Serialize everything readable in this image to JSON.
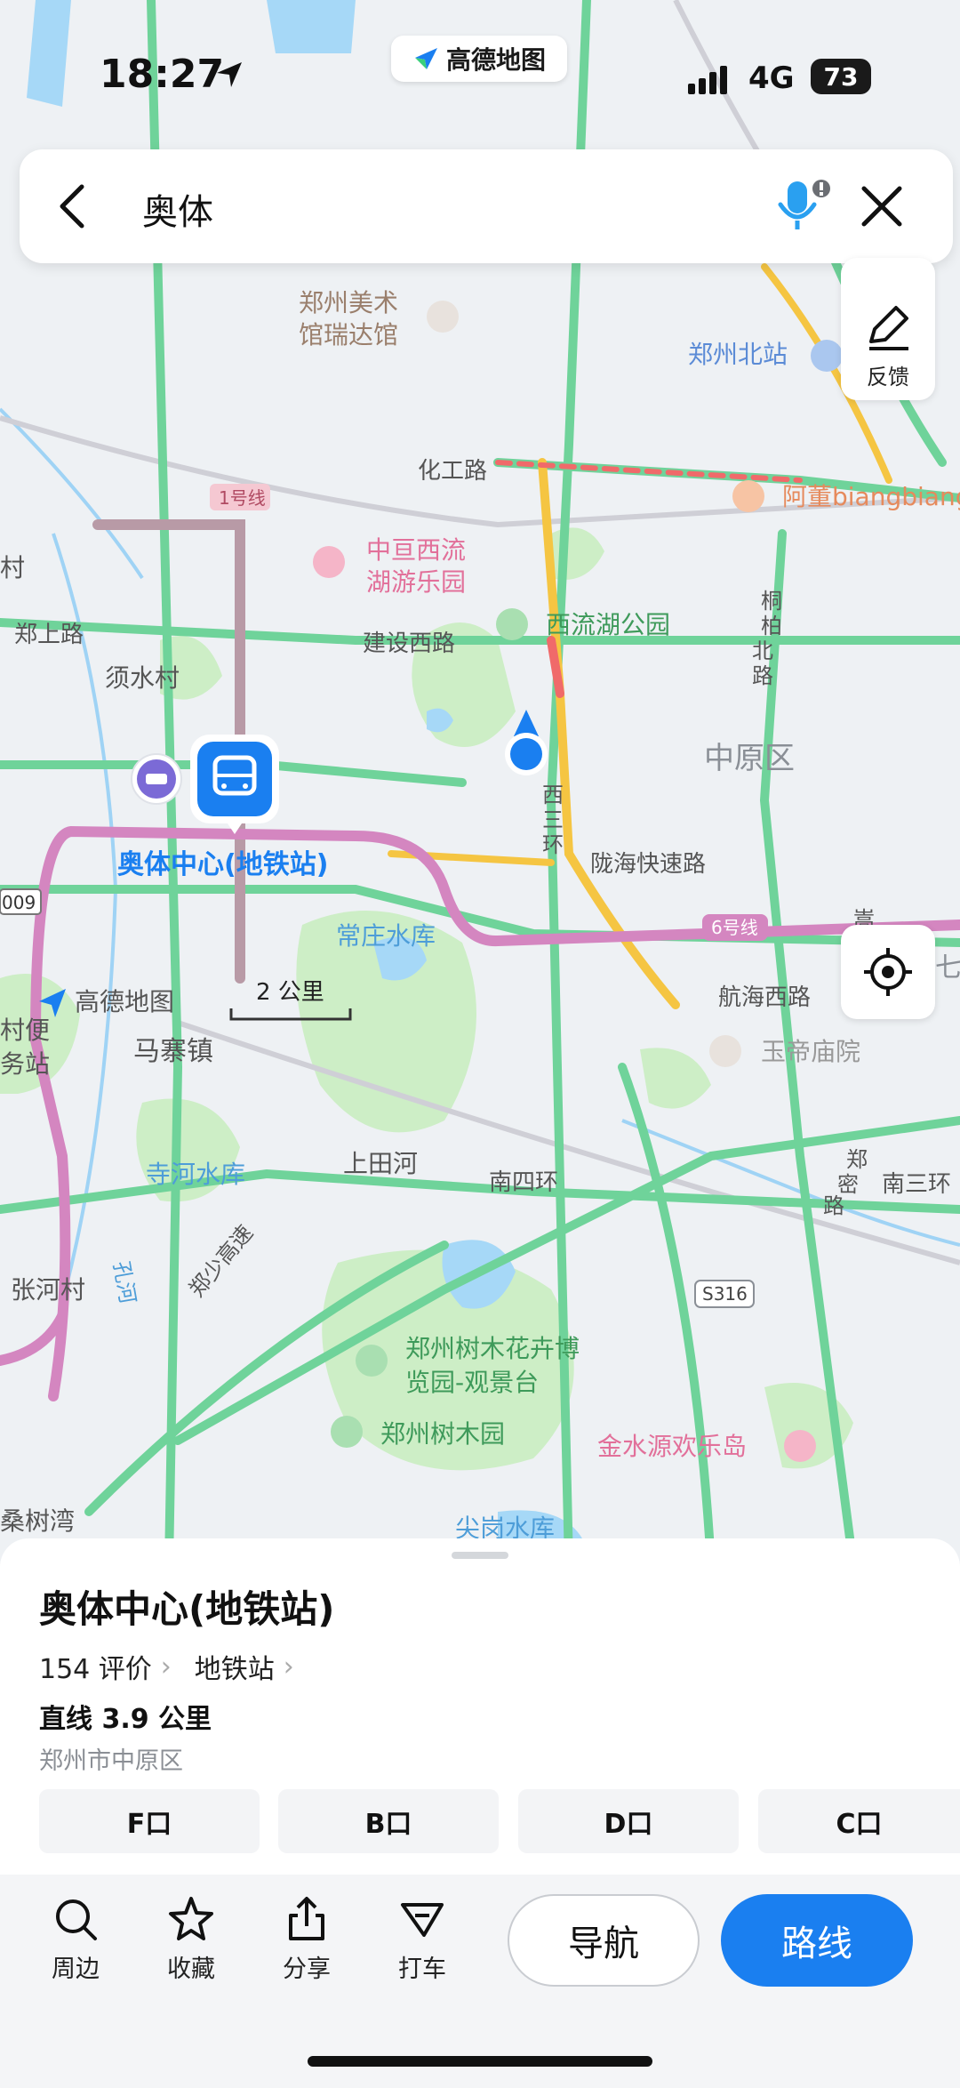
{
  "status_bar": {
    "time": "18:27",
    "app_name": "高德地图",
    "network": "4G",
    "battery": "73"
  },
  "search": {
    "query": "奥体"
  },
  "side_buttons": {
    "feedback_label": "反馈"
  },
  "map": {
    "scale_label": "2 公里",
    "watermark": "高德地图",
    "labels": {
      "l1": "郑州美术",
      "l2": "馆瑞达馆",
      "l3": "郑州北站",
      "l4": "化工路",
      "l5": "1号线",
      "l6": "阿董biangbiang",
      "l7": "中亘西流",
      "l8": "湖游乐园",
      "l9": "村",
      "l10": "郑上路",
      "l11": "建设西路",
      "l12": "西流湖公园",
      "l13": "须水村",
      "l14": "中原区",
      "l15": "西",
      "l16": "三",
      "l17": "环",
      "l18": "奥体中心(地铁站)",
      "l19": "陇海快速路",
      "l20": "009",
      "l21": "常庄水库",
      "l22": "6号线",
      "l23": "航海西路",
      "l24": "村便",
      "l25": "务站",
      "l26": "马寨镇",
      "l27": "玉帝庙院",
      "l28": "寺河水库",
      "l29": "上田河",
      "l30": "南四环",
      "l31": "南三环",
      "l32": "郑少高速",
      "l33": "S316",
      "l34": "张河村",
      "l35": "孔河",
      "l36": "郑州树木花卉博",
      "l37": "览园-观景台",
      "l38": "郑州树木园",
      "l39": "金水源欢乐岛",
      "l40": "桑树湾",
      "l41": "尖岗水库",
      "l42": "桐",
      "l43": "柏",
      "l44": "北",
      "l45": "路",
      "l46": "郑",
      "l47": "密",
      "l48": "路",
      "l49": "七",
      "l50": "嵩"
    }
  },
  "poi": {
    "name": "奥体中心(地铁站)",
    "reviews": "154 评价",
    "category": "地铁站",
    "distance": "直线 3.9 公里",
    "address": "郑州市中原区",
    "exits": [
      "F口",
      "B口",
      "D口",
      "C口"
    ]
  },
  "toolbar": {
    "nearby": "周边",
    "favorite": "收藏",
    "share": "分享",
    "taxi": "打车",
    "navigate": "导航",
    "route": "路线"
  },
  "colors": {
    "accent": "#1a7ff0",
    "metro_line": "#d486c0",
    "road_green": "#6fd39a",
    "park": "#c7ecc0",
    "water": "#9fd3f5"
  }
}
